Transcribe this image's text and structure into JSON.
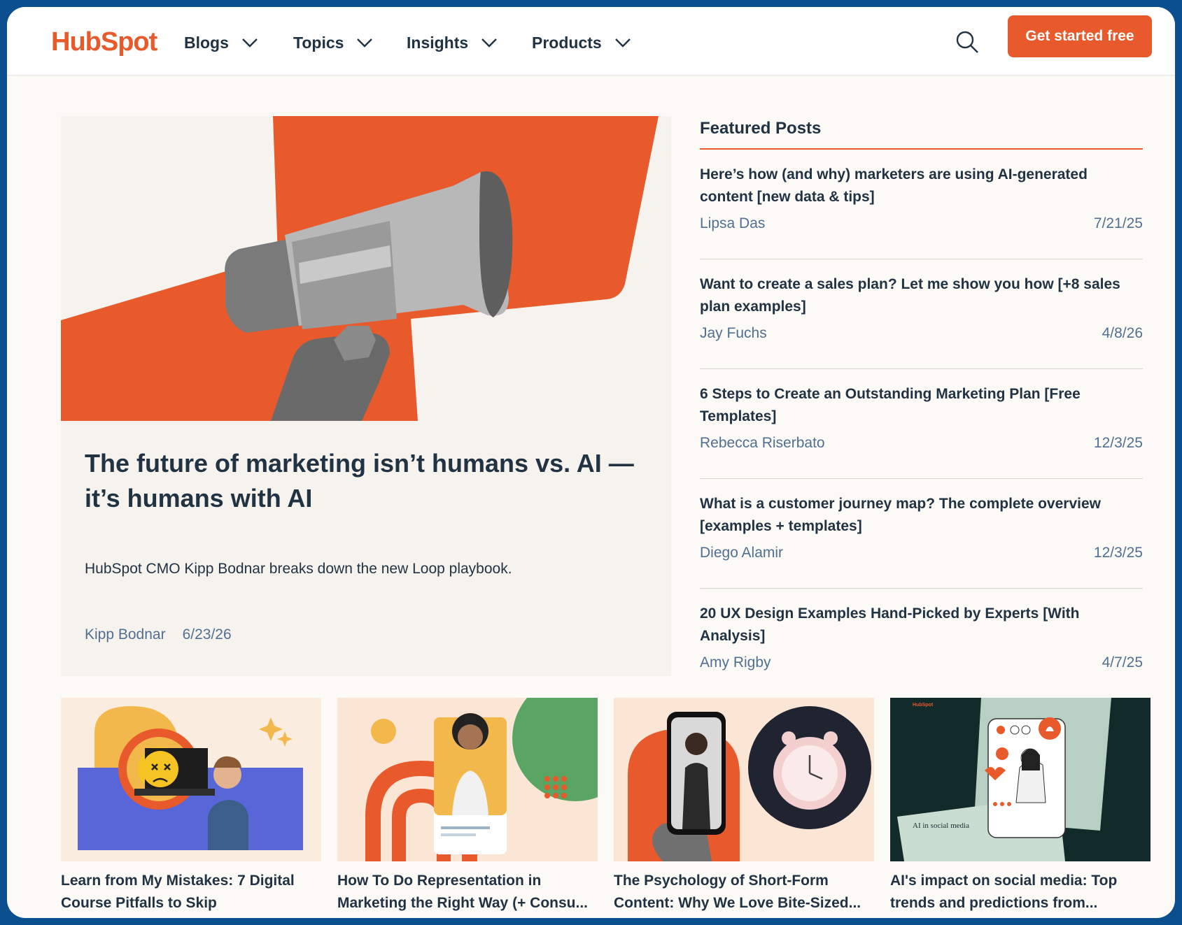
{
  "header": {
    "logo": "HubSpot",
    "nav": [
      {
        "label": "Blogs"
      },
      {
        "label": "Topics"
      },
      {
        "label": "Insights"
      },
      {
        "label": "Products"
      }
    ],
    "cta_label": "Get started free"
  },
  "hero": {
    "title": "The future of marketing isn’t humans vs. AI — it’s humans with AI",
    "description": "HubSpot CMO Kipp Bodnar breaks down the new Loop playbook.",
    "author": "Kipp Bodnar",
    "date": "6/23/26"
  },
  "featured": {
    "heading": "Featured Posts",
    "posts": [
      {
        "title": "Here’s how (and why) marketers are using AI-generated content [new data & tips]",
        "author": "Lipsa Das",
        "date": "7/21/25"
      },
      {
        "title": "Want to create a sales plan? Let me show you how [+8 sales plan examples]",
        "author": "Jay Fuchs",
        "date": "4/8/26"
      },
      {
        "title": "6 Steps to Create an Outstanding Marketing Plan [Free Templates]",
        "author": "Rebecca Riserbato",
        "date": "12/3/25"
      },
      {
        "title": "What is a customer journey map? The complete overview [examples + templates]",
        "author": "Diego Alamir",
        "date": "12/3/25"
      },
      {
        "title": "20 UX Design Examples Hand-Picked by Experts [With Analysis]",
        "author": "Amy Rigby",
        "date": "4/7/25"
      }
    ]
  },
  "cards": [
    {
      "title": "Learn from My Mistakes: 7 Digital Course Pitfalls to Skip"
    },
    {
      "title": "How To Do Representation in Marketing the Right Way (+ Consu..."
    },
    {
      "title": "The Psychology of Short-Form Content: Why We Love Bite-Sized..."
    },
    {
      "title": "AI's impact on social media: Top trends and predictions from...",
      "image_caption": "AI in social media",
      "image_logo": "HubSpot"
    }
  ],
  "colors": {
    "brand": "#e8592b",
    "text": "#213343",
    "muted": "#516f90",
    "frame": "#0b4f8f"
  }
}
